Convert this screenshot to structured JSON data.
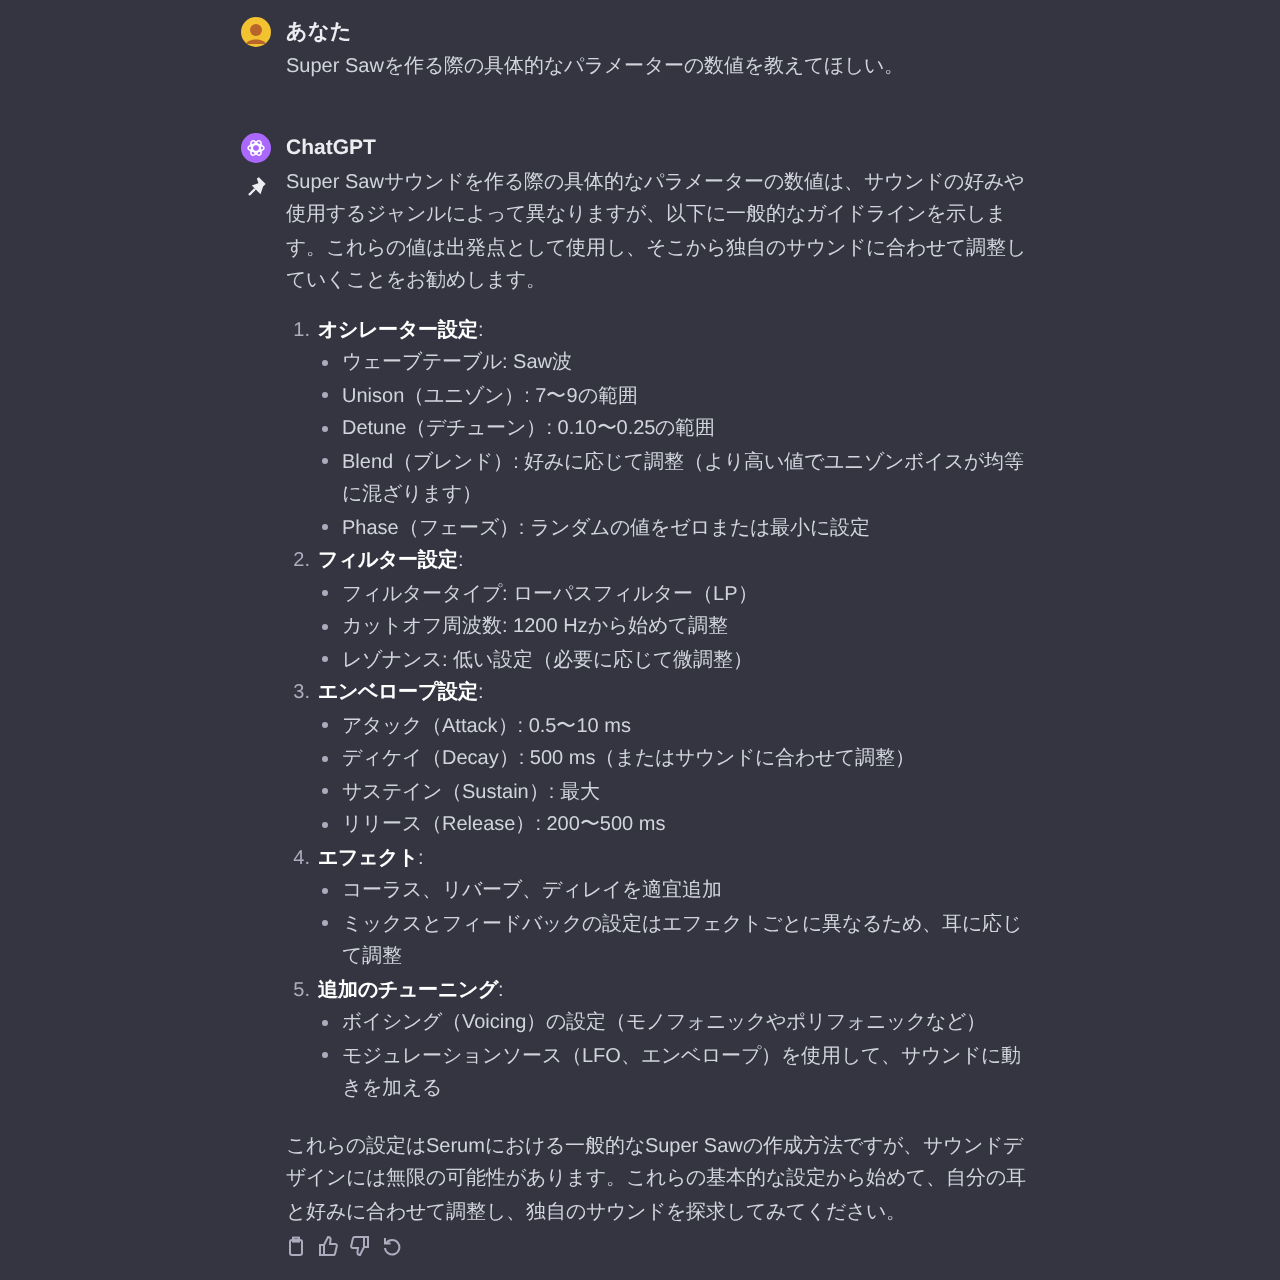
{
  "messages": [
    {
      "kind": "user",
      "author": "あなた",
      "text": "Super Sawを作る際の具体的なパラメーターの数値を教えてほしい。"
    },
    {
      "kind": "assistant",
      "author": "ChatGPT",
      "intro": "Super Sawサウンドを作る際の具体的なパラメーターの数値は、サウンドの好みや使用するジャンルによって異なりますが、以下に一般的なガイドラインを示します。これらの値は出発点として使用し、そこから独自のサウンドに合わせて調整していくことをお勧めします。",
      "sections": [
        {
          "number": "1.",
          "title": "**オシレーター設定**:",
          "items": [
            "ウェーブテーブル: Saw波",
            "Unison（ユニゾン）: 7〜9の範囲",
            "Detune（デチューン）: 0.10〜0.25の範囲",
            "Blend（ブレンド）: 好みに応じて調整（より高い値でユニゾンボイスが均等に混ざります）",
            "Phase（フェーズ）: ランダムの値をゼロまたは最小に設定"
          ]
        },
        {
          "number": "2.",
          "title": "**フィルター設定**:",
          "items": [
            "フィルタータイプ: ローパスフィルター（LP）",
            "カットオフ周波数: 1200 Hzから始めて調整",
            "レゾナンス: 低い設定（必要に応じて微調整）"
          ]
        },
        {
          "number": "3.",
          "title": "**エンベロープ設定**:",
          "items": [
            "アタック（Attack）: 0.5〜10 ms",
            "ディケイ（Decay）: 500 ms（またはサウンドに合わせて調整）",
            "サステイン（Sustain）: 最大",
            "リリース（Release）: 200〜500 ms"
          ]
        },
        {
          "number": "4.",
          "title": "**エフェクト**:",
          "items": [
            "コーラス、リバーブ、ディレイを適宜追加",
            "ミックスとフィードバックの設定はエフェクトごとに異なるため、耳に応じて調整"
          ]
        },
        {
          "number": "5.",
          "title": "**追加のチューニング**:",
          "items": [
            "ボイシング（Voicing）の設定（モノフォニックやポリフォニックなど）",
            "モジュレーションソース（LFO、エンベロープ）を使用して、サウンドに動きを加える"
          ]
        }
      ],
      "outro": "これらの設定はSerumにおける一般的なSuper Sawの作成方法ですが、サウンドデザインには無限の可能性があります。これらの基本的な設定から始めて、自分の耳と好みに合わせて調整し、独自のサウンドを探求してみてください。"
    }
  ]
}
